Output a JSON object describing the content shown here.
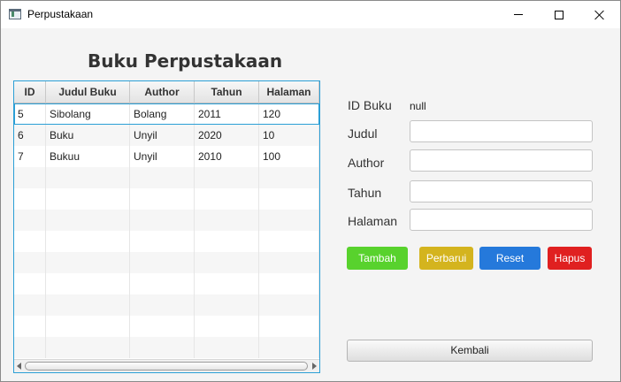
{
  "window": {
    "title": "Perpustakaan",
    "icon": "app-window-icon"
  },
  "heading": "Buku Perpustakaan",
  "table": {
    "columns": [
      "ID",
      "Judul Buku",
      "Author",
      "Tahun",
      "Halaman"
    ],
    "rows": [
      [
        "5",
        "Sibolang",
        "Bolang",
        "2011",
        "120"
      ],
      [
        "6",
        "Buku",
        "Unyil",
        "2020",
        "10"
      ],
      [
        "7",
        "Bukuu",
        "Unyil",
        "2010",
        "100"
      ]
    ],
    "selected_row": 0,
    "empty_rows": 9
  },
  "form": {
    "id_label": "ID Buku",
    "id_value": "null",
    "judul_label": "Judul",
    "judul_value": "",
    "author_label": "Author",
    "author_value": "",
    "tahun_label": "Tahun",
    "tahun_value": "",
    "halaman_label": "Halaman",
    "halaman_value": ""
  },
  "buttons": {
    "tambah": "Tambah",
    "perbarui": "Perbarui",
    "reset": "Reset",
    "hapus": "Hapus",
    "kembali": "Kembali"
  },
  "colors": {
    "tambah": "#58d22d",
    "perbarui": "#d4b41e",
    "reset": "#2579db",
    "hapus": "#e02020",
    "table_focus": "#2b9fd6"
  }
}
